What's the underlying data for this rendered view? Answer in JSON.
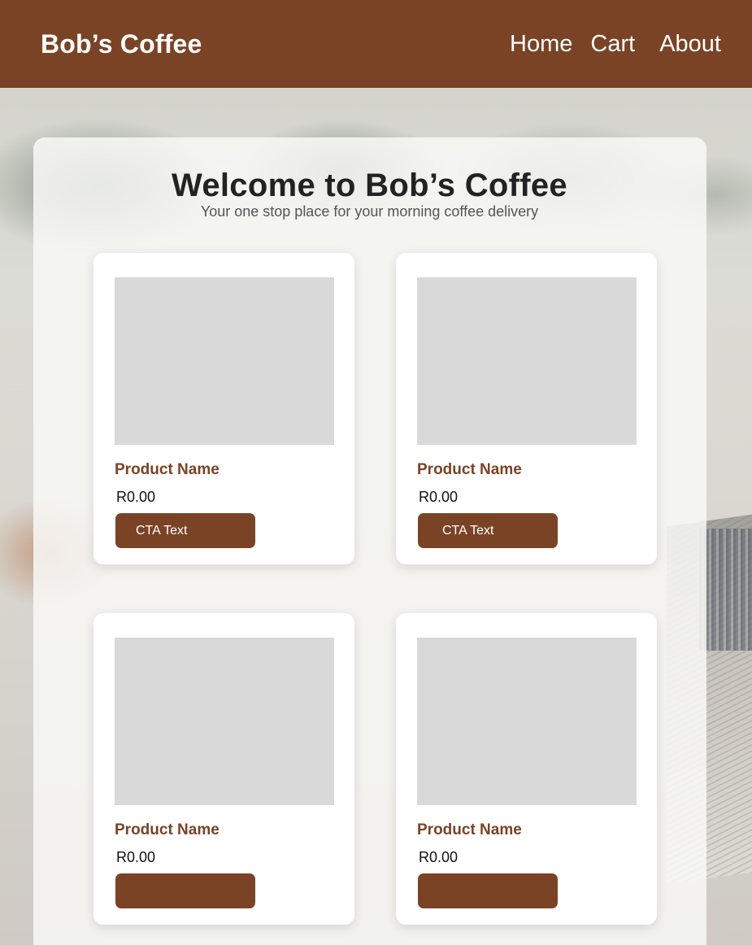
{
  "header": {
    "brand": "Bob’s Coffee",
    "nav": [
      "Home",
      "Cart",
      "About"
    ]
  },
  "hero": {
    "title": "Welcome to Bob’s Coffee",
    "subtitle": "Your one stop place for your morning coffee delivery"
  },
  "products": [
    {
      "name": "Product Name",
      "price": "R0.00",
      "cta": "CTA Text"
    },
    {
      "name": "Product Name",
      "price": "R0.00",
      "cta": "CTA Text"
    },
    {
      "name": "Product Name",
      "price": "R0.00",
      "cta": ""
    },
    {
      "name": "Product Name",
      "price": "R0.00",
      "cta": ""
    }
  ],
  "colors": {
    "brand_brown": "#7a4326",
    "image_placeholder": "#d9d9d9",
    "panel": "#f8f8f6"
  }
}
